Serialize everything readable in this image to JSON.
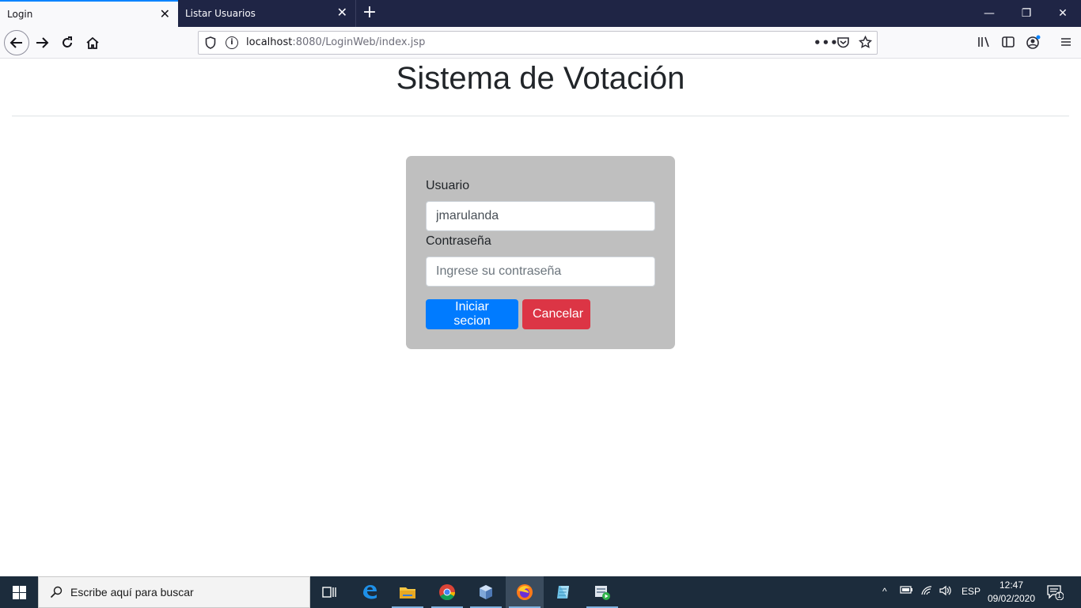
{
  "browser": {
    "tabs": [
      {
        "label": "Login",
        "active": true
      },
      {
        "label": "Listar Usuarios",
        "active": false
      }
    ],
    "url": {
      "host": "localhost",
      "rest": ":8080/LoginWeb/index.jsp"
    },
    "icons": [
      "back-icon",
      "forward-icon",
      "reload-icon",
      "home-icon",
      "shield-icon",
      "info-icon",
      "more-icon",
      "pocket-icon",
      "bookmark-star-icon",
      "library-icon",
      "sidebar-icon",
      "account-icon",
      "menu-icon"
    ]
  },
  "page": {
    "title": "Sistema de Votación",
    "form": {
      "user_label": "Usuario",
      "user_value": "jmarulanda",
      "password_label": "Contraseña",
      "password_placeholder": "Ingrese su contraseña",
      "submit_label": "Iniciar secion",
      "cancel_label": "Cancelar"
    },
    "colors": {
      "primary": "#007bff",
      "danger": "#dc3545",
      "card": "#bfbfbf"
    }
  },
  "taskbar": {
    "search_placeholder": "Escribe aquí para buscar",
    "apps": [
      "task-view-icon",
      "edge-icon",
      "file-explorer-icon",
      "chrome-icon",
      "virtualbox-icon",
      "firefox-icon",
      "notepad-icon",
      "media-app-icon"
    ],
    "language": "ESP",
    "time": "12:47",
    "date": "09/02/2020",
    "notifications": "1"
  }
}
